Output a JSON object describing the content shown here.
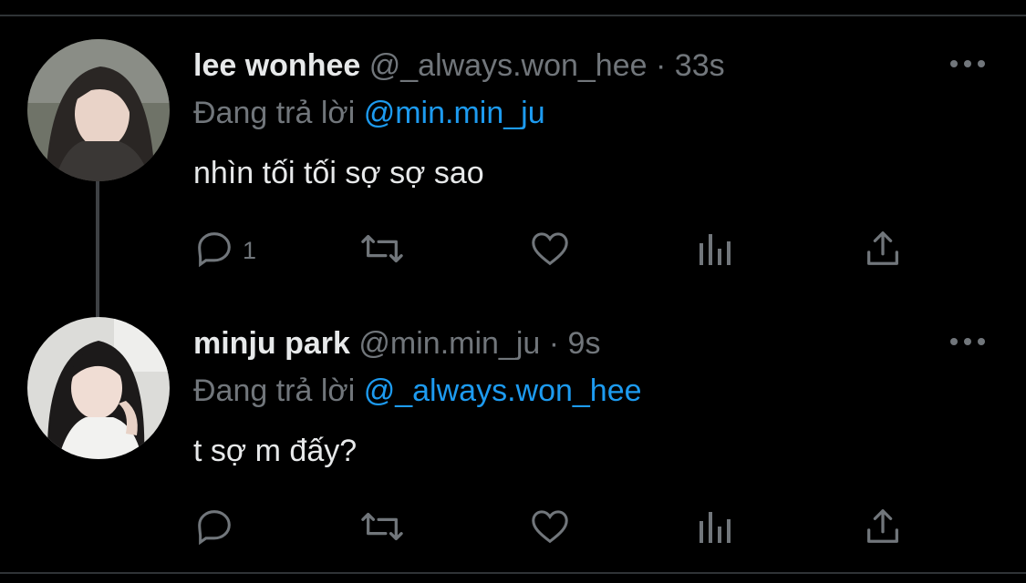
{
  "colors": {
    "background": "#000000",
    "text_primary": "#e7e9ea",
    "text_secondary": "#71767b",
    "accent": "#1d9bf0"
  },
  "tweets": [
    {
      "display_name": "lee wonhee",
      "handle": "@_always.won_hee",
      "separator": "·",
      "time": "33s",
      "reply_prefix": "Đang trả lời",
      "reply_to": "@min.min_ju",
      "text": "nhìn tối tối sợ sợ sao",
      "reply_count": "1",
      "icons": [
        "reply-icon",
        "retweet-icon",
        "like-icon",
        "analytics-icon",
        "share-icon",
        "more-icon"
      ]
    },
    {
      "display_name": "minju park",
      "handle": "@min.min_ju",
      "separator": "·",
      "time": "9s",
      "reply_prefix": "Đang trả lời",
      "reply_to": "@_always.won_hee",
      "text": "t sợ m đấy?",
      "reply_count": "",
      "icons": [
        "reply-icon",
        "retweet-icon",
        "like-icon",
        "analytics-icon",
        "share-icon",
        "more-icon"
      ]
    }
  ]
}
